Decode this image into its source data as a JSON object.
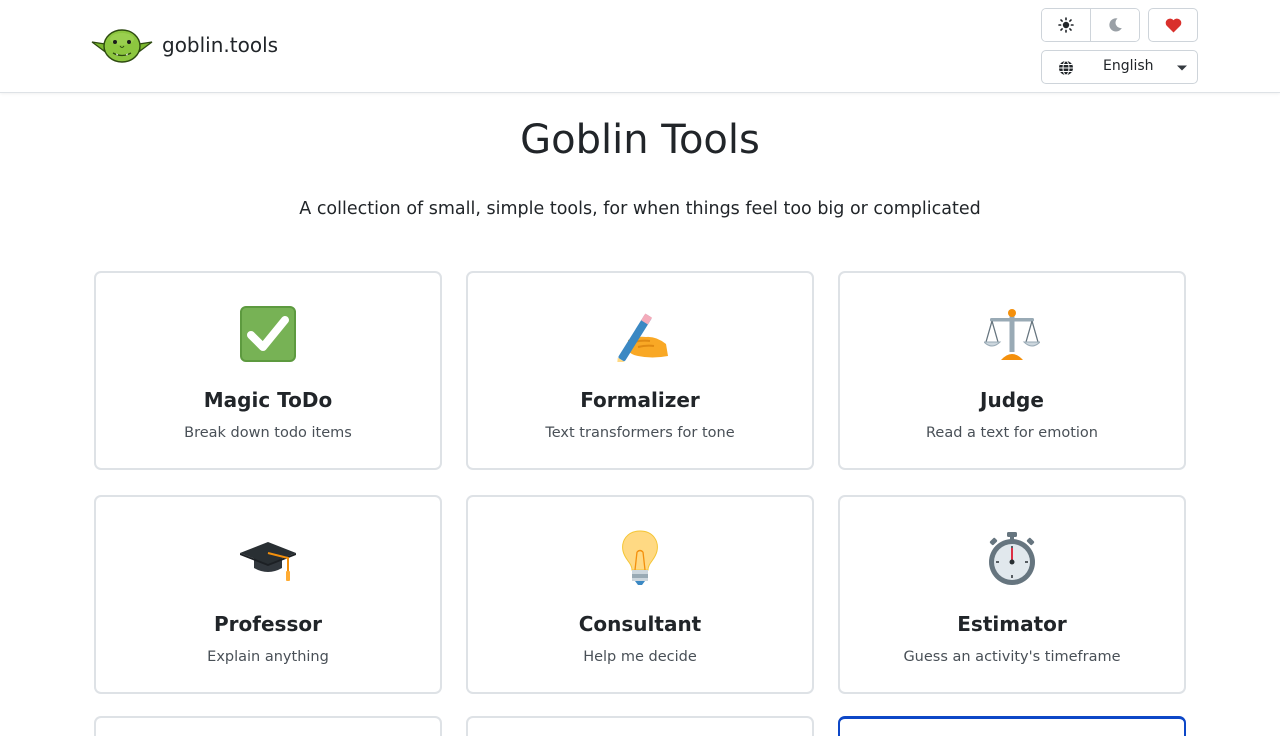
{
  "brand": {
    "name": "goblin.tools"
  },
  "header": {
    "language": {
      "selected": "English"
    },
    "colors": {
      "heart": "#d9302c",
      "accent": "#0d47c7",
      "border": "#dee2e6"
    }
  },
  "main": {
    "title": "Goblin Tools",
    "subtitle": "A collection of small, simple tools, for when things feel too big or complicated",
    "tools": [
      {
        "title": "Magic ToDo",
        "description": "Break down todo items",
        "icon": "check-mark-icon"
      },
      {
        "title": "Formalizer",
        "description": "Text transformers for tone",
        "icon": "writing-hand-icon"
      },
      {
        "title": "Judge",
        "description": "Read a text for emotion",
        "icon": "balance-scale-icon"
      },
      {
        "title": "Professor",
        "description": "Explain anything",
        "icon": "graduation-cap-icon"
      },
      {
        "title": "Consultant",
        "description": "Help me decide",
        "icon": "light-bulb-icon"
      },
      {
        "title": "Estimator",
        "description": "Guess an activity's timeframe",
        "icon": "stopwatch-icon"
      }
    ]
  }
}
